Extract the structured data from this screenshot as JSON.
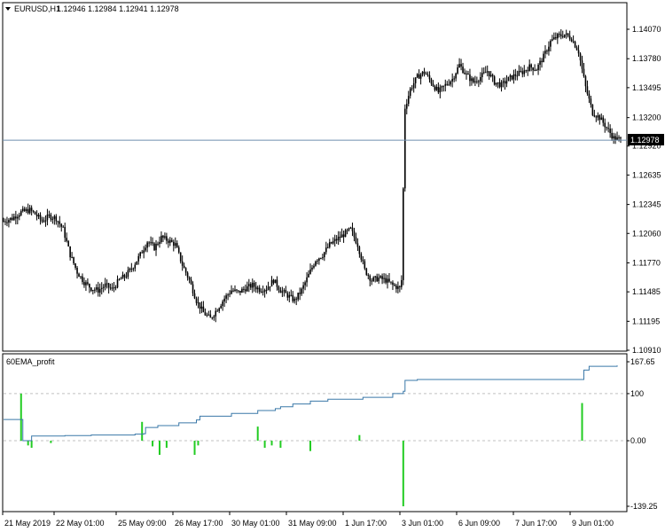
{
  "window": {
    "symbol_title": "EURUSD,H1",
    "ohlc": "1.12946 1.12984 1.12941 1.12978",
    "menu_icon": "triangle-down-icon"
  },
  "main_chart": {
    "price_axis_labels": [
      "1.14070",
      "1.13780",
      "1.13495",
      "1.13200",
      "1.12920",
      "1.12635",
      "1.12345",
      "1.12060",
      "1.11770",
      "1.11485",
      "1.11195",
      "1.10910"
    ],
    "current_price_tag": "1.12978",
    "current_price": 1.12978,
    "price_line_color": "#6f8faf",
    "candle_color": "#000000"
  },
  "indicator": {
    "name": "60EMA_profit",
    "axis_labels": [
      "167.65",
      "100",
      "0.00",
      "-139.25"
    ],
    "line_color": "#3a78a8",
    "histogram_color": "#22cc22",
    "current_value": 167.65
  },
  "time_axis": {
    "labels": [
      "21 May 2019",
      "22 May 01:00",
      "25 May 09:00",
      "26 May 17:00",
      "30 May 01:00",
      "31 May 09:00",
      "1 Jun 17:00",
      "3 Jun 01:00",
      "6 Jun 09:00",
      "7 Jun 17:00",
      "9 Jun 01:00"
    ]
  },
  "chart_data": [
    {
      "type": "candlestick",
      "title": "EURUSD,H1",
      "symbol": "EURUSD",
      "timeframe": "H1",
      "last_ohlc": {
        "open": 1.12946,
        "high": 1.12984,
        "low": 1.12941,
        "close": 1.12978
      },
      "ylim": [
        1.1091,
        1.1407
      ],
      "y_ticks": [
        1.1407,
        1.1378,
        1.13495,
        1.132,
        1.1292,
        1.12635,
        1.12345,
        1.1206,
        1.1177,
        1.11485,
        1.11195,
        1.1091
      ],
      "price_path": [
        [
          0,
          1.1218
        ],
        [
          5,
          1.1221
        ],
        [
          10,
          1.1227
        ],
        [
          15,
          1.1229
        ],
        [
          18,
          1.1225
        ],
        [
          22,
          1.1218
        ],
        [
          26,
          1.1223
        ],
        [
          30,
          1.1221
        ],
        [
          34,
          1.121
        ],
        [
          38,
          1.1185
        ],
        [
          42,
          1.1168
        ],
        [
          46,
          1.1158
        ],
        [
          50,
          1.1152
        ],
        [
          54,
          1.115
        ],
        [
          58,
          1.1155
        ],
        [
          62,
          1.1151
        ],
        [
          66,
          1.116
        ],
        [
          70,
          1.1165
        ],
        [
          74,
          1.1174
        ],
        [
          78,
          1.1185
        ],
        [
          82,
          1.1198
        ],
        [
          86,
          1.1192
        ],
        [
          90,
          1.1202
        ],
        [
          94,
          1.1199
        ],
        [
          98,
          1.1195
        ],
        [
          102,
          1.1175
        ],
        [
          106,
          1.116
        ],
        [
          110,
          1.114
        ],
        [
          114,
          1.1128
        ],
        [
          118,
          1.1122
        ],
        [
          122,
          1.1132
        ],
        [
          126,
          1.1142
        ],
        [
          130,
          1.115
        ],
        [
          134,
          1.1148
        ],
        [
          138,
          1.1152
        ],
        [
          142,
          1.1155
        ],
        [
          146,
          1.1151
        ],
        [
          150,
          1.1152
        ],
        [
          154,
          1.116
        ],
        [
          158,
          1.115
        ],
        [
          162,
          1.1145
        ],
        [
          166,
          1.114
        ],
        [
          170,
          1.115
        ],
        [
          174,
          1.1165
        ],
        [
          178,
          1.118
        ],
        [
          182,
          1.1185
        ],
        [
          186,
          1.1195
        ],
        [
          190,
          1.12
        ],
        [
          194,
          1.1205
        ],
        [
          198,
          1.121
        ],
        [
          202,
          1.1195
        ],
        [
          206,
          1.117
        ],
        [
          210,
          1.116
        ],
        [
          214,
          1.1162
        ],
        [
          218,
          1.116
        ],
        [
          222,
          1.1155
        ],
        [
          226,
          1.1152
        ],
        [
          227,
          1.116
        ],
        [
          228,
          1.125
        ],
        [
          229,
          1.133
        ],
        [
          232,
          1.1348
        ],
        [
          236,
          1.136
        ],
        [
          240,
          1.1365
        ],
        [
          244,
          1.1355
        ],
        [
          248,
          1.1345
        ],
        [
          252,
          1.1352
        ],
        [
          256,
          1.1358
        ],
        [
          260,
          1.1372
        ],
        [
          264,
          1.1362
        ],
        [
          268,
          1.1355
        ],
        [
          272,
          1.136
        ],
        [
          276,
          1.1366
        ],
        [
          280,
          1.1355
        ],
        [
          284,
          1.1352
        ],
        [
          288,
          1.1358
        ],
        [
          292,
          1.1362
        ],
        [
          296,
          1.1365
        ],
        [
          300,
          1.137
        ],
        [
          304,
          1.1368
        ],
        [
          308,
          1.138
        ],
        [
          312,
          1.1395
        ],
        [
          316,
          1.14
        ],
        [
          320,
          1.1402
        ],
        [
          324,
          1.1398
        ],
        [
          328,
          1.1385
        ],
        [
          332,
          1.135
        ],
        [
          336,
          1.1325
        ],
        [
          340,
          1.132
        ],
        [
          344,
          1.131
        ],
        [
          348,
          1.13
        ],
        [
          352,
          1.1298
        ]
      ]
    },
    {
      "type": "line+histogram",
      "title": "60EMA_profit",
      "ylim": [
        -139.25,
        167.65
      ],
      "y_ticks": [
        167.65,
        100,
        0,
        -139.25
      ],
      "line": [
        [
          0,
          45
        ],
        [
          10,
          45
        ],
        [
          11,
          0
        ],
        [
          16,
          10
        ],
        [
          30,
          10
        ],
        [
          35,
          11
        ],
        [
          50,
          12
        ],
        [
          75,
          14
        ],
        [
          80,
          15
        ],
        [
          81,
          28
        ],
        [
          88,
          32
        ],
        [
          100,
          38
        ],
        [
          110,
          44
        ],
        [
          112,
          52
        ],
        [
          130,
          58
        ],
        [
          145,
          64
        ],
        [
          155,
          68
        ],
        [
          158,
          72
        ],
        [
          165,
          78
        ],
        [
          175,
          84
        ],
        [
          185,
          88
        ],
        [
          195,
          88
        ],
        [
          205,
          92
        ],
        [
          222,
          100
        ],
        [
          228,
          105
        ],
        [
          229,
          128
        ],
        [
          236,
          130
        ],
        [
          260,
          130
        ],
        [
          290,
          130
        ],
        [
          330,
          130
        ],
        [
          331,
          150
        ],
        [
          334,
          158
        ],
        [
          350,
          160
        ]
      ],
      "bars": [
        [
          10,
          100
        ],
        [
          14,
          -10
        ],
        [
          16,
          -15
        ],
        [
          27,
          -5
        ],
        [
          79,
          40
        ],
        [
          85,
          -12
        ],
        [
          89,
          -30
        ],
        [
          93,
          -15
        ],
        [
          109,
          -30
        ],
        [
          111,
          -10
        ],
        [
          145,
          30
        ],
        [
          149,
          -15
        ],
        [
          153,
          -10
        ],
        [
          158,
          -15
        ],
        [
          175,
          -22
        ],
        [
          203,
          12
        ],
        [
          228,
          -139.25
        ],
        [
          330,
          80
        ]
      ]
    }
  ]
}
